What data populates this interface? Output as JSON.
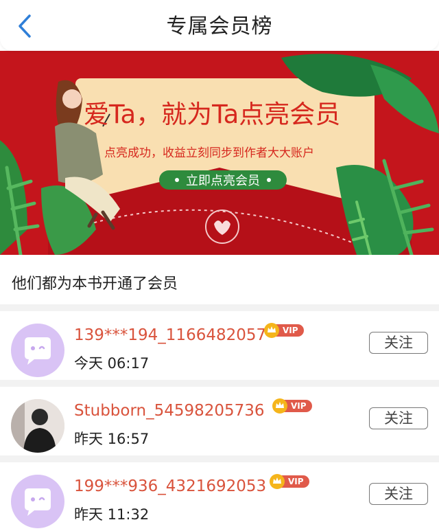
{
  "header": {
    "title": "专属会员榜"
  },
  "banner": {
    "headline": "爱Ta，就为Ta点亮会员",
    "subline": "点亮成功，收益立刻同步到作者大大账户",
    "cta_label": "立即点亮会员",
    "colors": {
      "background": "#c4151c",
      "card": "#f9dfb1",
      "cta": "#2e8b3d"
    }
  },
  "members_section": {
    "title": "他们都为本书开通了会员",
    "members": [
      {
        "name": "139***194_1166482057",
        "badge": "VIP",
        "time": "今天 06:17",
        "follow_label": "关注",
        "avatar": "default-purple"
      },
      {
        "name": "Stubborn_54598205736",
        "badge": "VIP",
        "time": "昨天 16:57",
        "follow_label": "关注",
        "avatar": "photo"
      },
      {
        "name": "199***936_4321692053",
        "badge": "VIP",
        "time": "昨天 11:32",
        "follow_label": "关注",
        "avatar": "default-purple"
      }
    ]
  },
  "colors": {
    "accent": "#d9533c",
    "vip": "#e05a4a",
    "avatar_bg": "#d9c3f5"
  }
}
